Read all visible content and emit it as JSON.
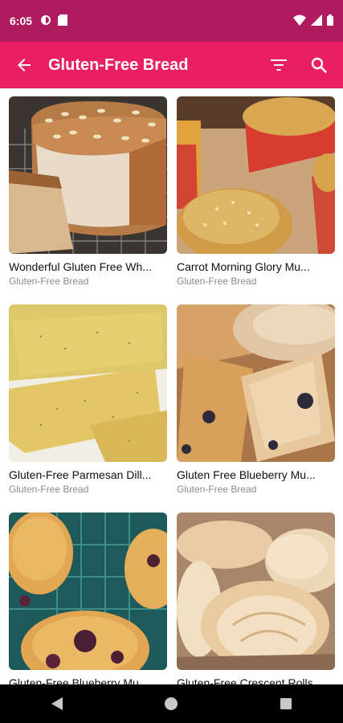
{
  "status_bar": {
    "time": "6:05",
    "icons": [
      "notification-icon",
      "sd-card-icon",
      "wifi-icon",
      "signal-icon",
      "battery-icon"
    ]
  },
  "app_bar": {
    "title": "Gluten-Free Bread",
    "back_icon": "arrow-back-icon",
    "filter_icon": "filter-icon",
    "search_icon": "search-icon"
  },
  "recipes": [
    {
      "name": "Wonderful Gluten Free Wh...",
      "category": "Gluten-Free Bread"
    },
    {
      "name": "Carrot Morning Glory Mu...",
      "category": "Gluten-Free Bread"
    },
    {
      "name": "Gluten-Free Parmesan Dill...",
      "category": "Gluten-Free Bread"
    },
    {
      "name": "Gluten Free Blueberry Mu...",
      "category": "Gluten-Free Bread"
    },
    {
      "name": "Gluten-Free Blueberry Mu...",
      "category": ""
    },
    {
      "name": "Gluten-Free Crescent Rolls",
      "category": ""
    }
  ],
  "colors": {
    "status_bar": "#b01c5e",
    "app_bar": "#e91e63",
    "nav_bar": "#000000"
  },
  "nav_bar": {
    "icons": [
      "back-triangle-icon",
      "home-circle-icon",
      "recents-square-icon"
    ]
  }
}
